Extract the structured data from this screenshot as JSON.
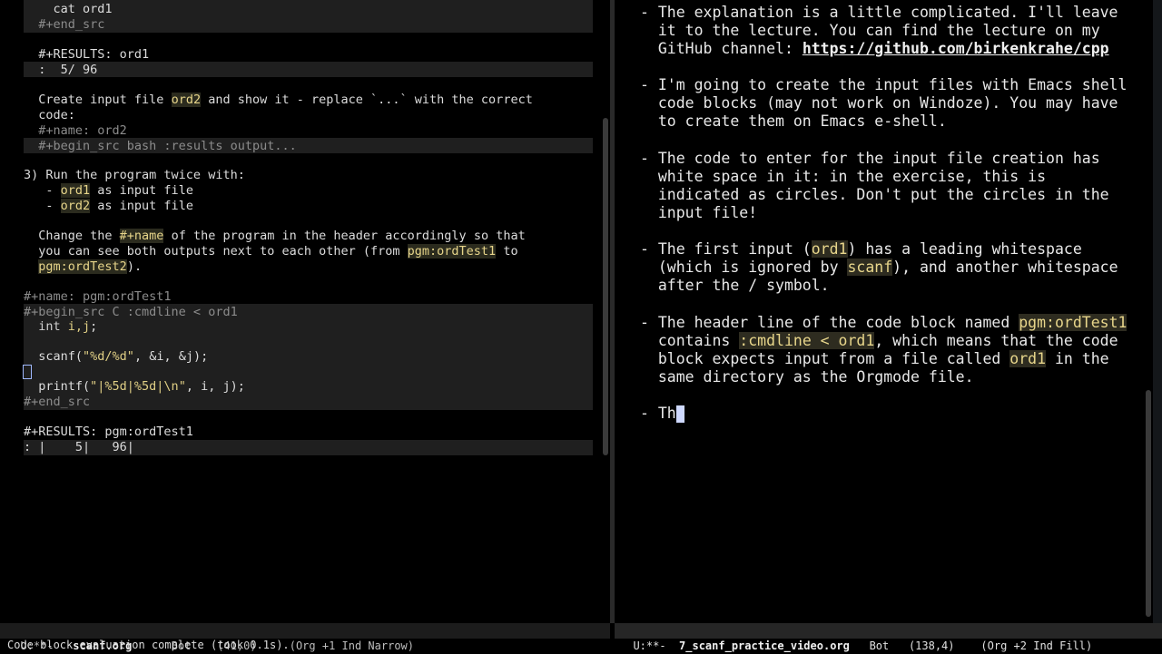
{
  "left": {
    "lines": [
      "    cat ord1",
      "  #+end_src",
      "  #+RESULTS: ord1",
      "  :  5/ 96",
      "  Create input file ",
      "ord2",
      " and show it - replace `...` with the correct",
      "  code:",
      "  #+name: ord2",
      "  #+begin_src bash :results output...",
      "3) Run the program twice with:",
      "   - ",
      "ord1",
      " as input file",
      "   - ",
      "ord2",
      " as input file",
      "  Change the ",
      "#+name",
      " of the program in the header accordingly so that",
      "  you can see both outputs next to each other (from ",
      "pgm:ordTest1",
      " to",
      "  ",
      "pgm:ordTest2",
      ").",
      "#+name: pgm:ordTest1",
      "#+begin_src C :cmdline < ord1",
      "  int ",
      "i,j",
      ";",
      "  scanf(",
      "\"%d/%d\"",
      ", &i, &j);",
      "  printf(",
      "\"|%5d|%5d|\\n\"",
      ", i, j);",
      "#+end_src",
      "#+RESULTS: pgm:ordTest1",
      ": |    5|   96|"
    ]
  },
  "right": {
    "p1": [
      "- The explanation is a little complicated. I'll leave",
      "  it to the lecture. You can find the lecture on my",
      "  GitHub channel: ",
      "https://github.com/birkenkrahe/cpp"
    ],
    "p2": [
      "- I'm going to create the input files with Emacs shell",
      "  code blocks (may not work on Windoze). You may have",
      "  to create them on Emacs e-shell."
    ],
    "p3": [
      "- The code to enter for the input file creation has",
      "  white space in it: in the exercise, this is",
      "  indicated as circles. Don't put the circles in the",
      "  input file!"
    ],
    "p4": [
      "- The first input (",
      "ord1",
      ") has a leading whitespace",
      "  (which is ignored by ",
      "scanf",
      "), and another whitespace",
      "  after the / symbol."
    ],
    "p5": [
      "- The header line of the code block named ",
      "pgm:ordTest1",
      "  contains ",
      ":cmdline < ord1",
      ", which means that the code",
      "  block expects input from a file called ",
      "ord1",
      " in the",
      "  same directory as the Orgmode file."
    ],
    "p6": "- Th"
  },
  "modeline_left": {
    "state": "U:**-",
    "buffer": "scanf.org",
    "pos": "Bot",
    "linecol": "(41,0)",
    "modes": "(Org +1 Ind Narrow)"
  },
  "modeline_right": {
    "state": "U:**-",
    "buffer": "7_scanf_practice_video.org",
    "pos": "Bot",
    "linecol": "(138,4)",
    "modes": "(Org +2 Ind Fill)"
  },
  "minibuffer": "Code block evaluation complete (took 0.1s).",
  "colors": {
    "background": "#000000",
    "highlight_text": "#e7d58a",
    "highlight_bg": "#2b2b1e",
    "modeline_bg": "#1c1c1c"
  }
}
